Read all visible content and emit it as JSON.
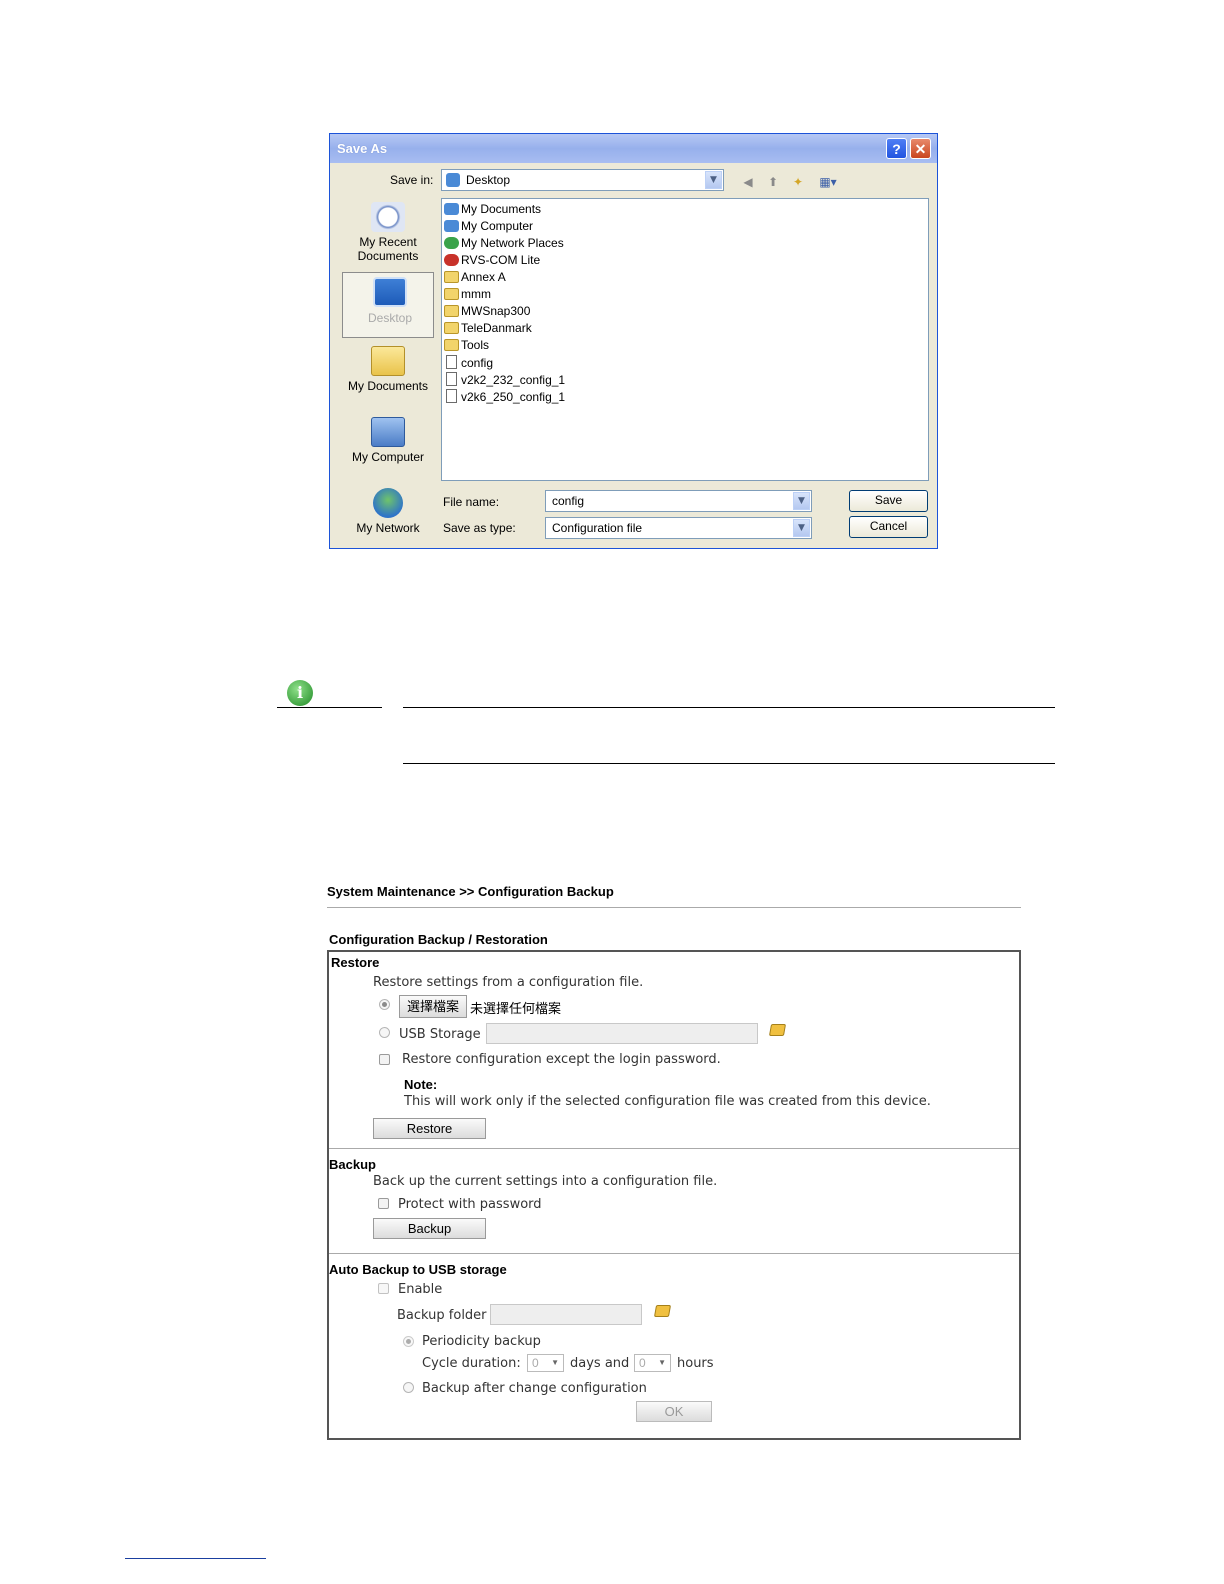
{
  "dialog": {
    "title": "Save As",
    "help_glyph": "?",
    "close_glyph": "✕",
    "save_in_label": "Save in:",
    "save_in_value": "Desktop",
    "places": [
      {
        "label_line1": "My Recent",
        "label_line2": "Documents",
        "icon": "recent-documents-icon"
      },
      {
        "label_line1": "Desktop",
        "label_line2": "",
        "icon": "desktop-icon"
      },
      {
        "label_line1": "My Documents",
        "label_line2": "",
        "icon": "my-documents-icon"
      },
      {
        "label_line1": "My Computer",
        "label_line2": "",
        "icon": "my-computer-icon"
      },
      {
        "label_line1": "My Network",
        "label_line2": "",
        "icon": "my-network-icon"
      }
    ],
    "files": [
      {
        "name": "My Documents",
        "type": "sys"
      },
      {
        "name": "My Computer",
        "type": "sys"
      },
      {
        "name": "My Network Places",
        "type": "sys"
      },
      {
        "name": "RVS-COM Lite",
        "type": "app"
      },
      {
        "name": "Annex A",
        "type": "folder"
      },
      {
        "name": "mmm",
        "type": "folder"
      },
      {
        "name": "MWSnap300",
        "type": "folder"
      },
      {
        "name": "TeleDanmark",
        "type": "folder"
      },
      {
        "name": "Tools",
        "type": "folder"
      },
      {
        "name": "config",
        "type": "doc"
      },
      {
        "name": "v2k2_232_config_1",
        "type": "doc"
      },
      {
        "name": "v2k6_250_config_1",
        "type": "doc"
      }
    ],
    "file_name_label": "File name:",
    "file_name_value": "config",
    "save_as_type_label": "Save as type:",
    "save_as_type_value": "Configuration file",
    "save_button": "Save",
    "cancel_button": "Cancel"
  },
  "note": {
    "icon_glyph": "i"
  },
  "web": {
    "breadcrumb": "System Maintenance >> Configuration Backup",
    "section_title": "Configuration Backup / Restoration",
    "restore": {
      "heading": "Restore",
      "desc": "Restore settings from a configuration file.",
      "choose_file_button": "選擇檔案",
      "no_file_text": "未選擇任何檔案",
      "usb_storage_label": "USB Storage",
      "except_password_label": "Restore configuration except the login password.",
      "note_heading": "Note:",
      "note_text": "This will work only if the selected configuration file was created from this device.",
      "restore_button": "Restore"
    },
    "backup": {
      "heading": "Backup",
      "desc": "Back up the current settings into a configuration file.",
      "protect_label": "Protect with password",
      "backup_button": "Backup"
    },
    "auto": {
      "heading": "Auto Backup to USB storage",
      "enable_label": "Enable",
      "folder_label": "Backup folder",
      "periodicity_label": "Periodicity backup",
      "cycle_label": "Cycle duration:",
      "days_value": "0",
      "days_label": "days and",
      "hours_value": "0",
      "hours_label": "hours",
      "after_change_label": "Backup after change configuration",
      "ok_button": "OK"
    }
  }
}
